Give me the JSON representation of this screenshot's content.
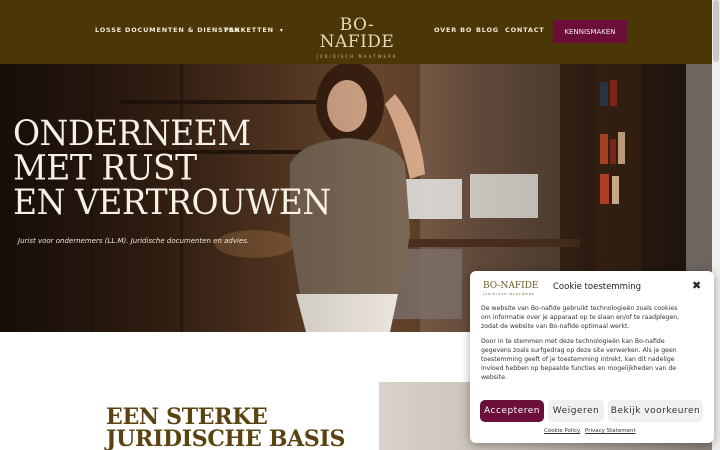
{
  "header": {
    "nav_left": [
      "LOSSE DOCUMENTEN & DIENSTEN",
      "PAKKETTEN"
    ],
    "nav_right": [
      "OVER BO",
      "BLOG",
      "CONTACT"
    ],
    "logo_main": "BO-NAFIDE",
    "logo_sub": "JURIDISCH MAATWERK",
    "cta_label": "KENNISMAKEN",
    "caret_icon": "chevron-down-icon"
  },
  "hero": {
    "title_lines": [
      "ONDERNEEM",
      "MET RUST",
      "EN VERTROUWEN"
    ],
    "subtitle": "Jurist voor ondernemers (LL.M). Juridische documenten en advies."
  },
  "section": {
    "heading_lines": [
      "EEN STERKE",
      "JURIDISCHE BASIS"
    ]
  },
  "cookie": {
    "logo_main": "BO-NAFIDE",
    "logo_sub": "JURIDISCH MAATWERK",
    "title": "Cookie toestemming",
    "close_symbol": "✖",
    "paragraph_1": "De website van Bo-nafide gebruikt technologieën zoals cookies om informatie over je apparaat op te slaan en/of te raadplegen, zodat de website van Bo-nafide optimaal werkt.",
    "paragraph_2": "Door in te stemmen met deze technologieën kan Bo-nafide gegevens zoals surfgedrag op deze site verwerken. Als je geen toestemming geeft of je toestemming intrekt, kan dit nadelige invloed hebben op bepaalde functies en mogelijkheden van de website.",
    "accept_label": "Accepteren",
    "deny_label": "Weigeren",
    "prefs_label": "Bekijk voorkeuren",
    "policy_link": "Cookie Policy",
    "privacy_link": "Privacy Statement"
  },
  "colors": {
    "header_bg": "#4a3606",
    "accent": "#6b0e3a",
    "heading_gold": "#5a4310"
  }
}
